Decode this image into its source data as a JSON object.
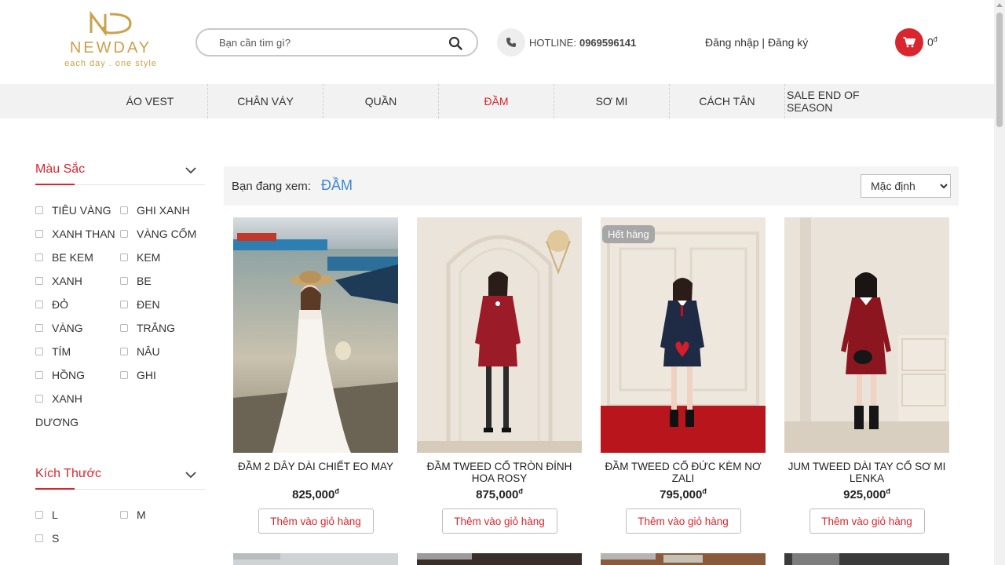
{
  "header": {
    "logo": {
      "brand": "NEWDAY",
      "tagline": "each day . one style"
    },
    "search": {
      "placeholder": "Bạn cần tìm gì?"
    },
    "hotline": {
      "label": "HOTLINE:",
      "number": "0969596141"
    },
    "auth": {
      "login": "Đăng nhập",
      "separator": " | ",
      "register": "Đăng ký"
    },
    "cart": {
      "total": "0",
      "currency": "đ"
    }
  },
  "nav": {
    "items": [
      {
        "label": "ÁO VEST"
      },
      {
        "label": "CHÂN VÁY"
      },
      {
        "label": "QUẦN"
      },
      {
        "label": "ĐẦM",
        "active": true
      },
      {
        "label": "SƠ MI"
      },
      {
        "label": "CÁCH TÂN"
      },
      {
        "label": "SALE END OF SEASON"
      }
    ]
  },
  "filters": {
    "color": {
      "title": "Màu Sắc",
      "options": [
        "TIÊU VÀNG",
        "GHI XANH",
        "XANH THAN",
        "VÀNG CỐM",
        "BE KEM",
        "KEM",
        "XANH",
        "BE",
        "ĐỎ",
        "ĐEN",
        "VÀNG",
        "TRẮNG",
        "TÍM",
        "NÂU",
        "HỒNG",
        "GHI",
        "XANH DƯƠNG"
      ]
    },
    "size": {
      "title": "Kích Thước",
      "options": [
        "L",
        "M",
        "S"
      ]
    }
  },
  "main": {
    "breadcrumb_label": "Bạn đang xem:",
    "breadcrumb_current": "ĐẦM",
    "sort": {
      "selected": "Mặc định"
    },
    "products": [
      {
        "name": "ĐẦM 2 DÂY DÀI CHIẾT EO MAY",
        "price": "825,000",
        "currency": "đ",
        "button": "Thêm vào giỏ hàng"
      },
      {
        "name": "ĐẦM TWEED CỔ TRÒN ĐÍNH HOA ROSY",
        "price": "875,000",
        "currency": "đ",
        "button": "Thêm vào giỏ hàng"
      },
      {
        "name": "ĐẦM TWEED CỔ ĐỨC KÈM NƠ ZALI",
        "price": "795,000",
        "currency": "đ",
        "button": "Thêm vào giỏ hàng",
        "badge": "Hết hàng"
      },
      {
        "name": "JUM TWEED DÀI TAY CỔ SƠ MI LENKA",
        "price": "925,000",
        "currency": "đ",
        "button": "Thêm vào giỏ hàng"
      }
    ]
  },
  "colors": {
    "accent": "#d9262e",
    "link": "#3b86d6",
    "gold": "#c9a24b"
  }
}
